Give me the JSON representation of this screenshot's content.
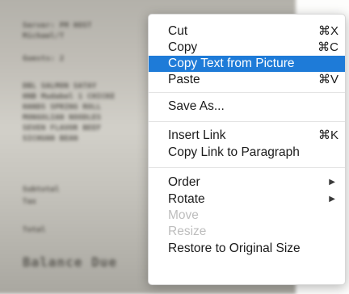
{
  "receipt": {
    "lines": [
      "Server: PM HOST",
      "Michael/T",
      "Guests: 2",
      "DBL SALMON SATAY",
      "HNB Mudabel 1 CHICKE",
      "HANDS SPRING ROLL",
      "MONGOLIAN NOODLES",
      "SEVEN FLAVOR BEEF",
      "SICHUAN BEAN",
      "Subtotal",
      "Tax",
      "Total",
      "Balance Due"
    ]
  },
  "context_menu": {
    "cut": {
      "label": "Cut",
      "shortcut": "⌘X"
    },
    "copy": {
      "label": "Copy",
      "shortcut": "⌘C"
    },
    "copy_text_from_picture": {
      "label": "Copy Text from Picture"
    },
    "paste": {
      "label": "Paste",
      "shortcut": "⌘V"
    },
    "save_as": {
      "label": "Save As..."
    },
    "insert_link": {
      "label": "Insert Link",
      "shortcut": "⌘K"
    },
    "copy_link_to_paragraph": {
      "label": "Copy Link to Paragraph"
    },
    "order": {
      "label": "Order",
      "submenu_arrow": "▶"
    },
    "rotate": {
      "label": "Rotate",
      "submenu_arrow": "▶"
    },
    "move": {
      "label": "Move"
    },
    "resize": {
      "label": "Resize"
    },
    "restore_to_original_size": {
      "label": "Restore to Original Size"
    },
    "selected_item": "Copy Text from Picture",
    "disabled_items": [
      "Move",
      "Resize"
    ],
    "highlight_color": "#1e7bd8"
  }
}
